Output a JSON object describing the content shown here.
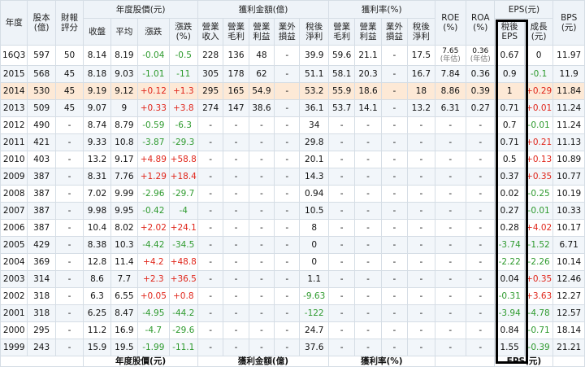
{
  "group_headers": {
    "year": "年度",
    "capital": "股本\n(億)",
    "rating": "財報\n評分",
    "price": "年度股價(元)",
    "profit": "獲利金額(億)",
    "margin": "獲利率(%)",
    "roe": "ROE\n(%)",
    "roa": "ROA\n(%)",
    "eps": "EPS(元)",
    "bps": "BPS\n(元)"
  },
  "sub_headers": {
    "close": "收盤",
    "avg": "平均",
    "change": "漲跌",
    "change_pct": "漲跌\n(%)",
    "rev": "營業\n收入",
    "gross": "營業\n毛利",
    "opinc": "營業\n利益",
    "nonop": "業外\n損益",
    "net": "稅後\n淨利",
    "m_gross": "營業\n毛利",
    "m_op": "營業\n利益",
    "m_nonop": "業外\n損益",
    "m_net": "稅後\n淨利",
    "eps": "稅後\nEPS",
    "growth": "成長\n(元)"
  },
  "footer_labels": [
    "年度股價(元)",
    "獲利金額(億)",
    "獲利率(%)",
    "EPS(元)"
  ],
  "rows": [
    [
      "16Q3",
      "597",
      "50",
      "8.14",
      "8.19",
      "-0.04",
      "-0.5",
      "228",
      "136",
      "48",
      "-",
      "39.9",
      "59.6",
      "21.1",
      "-",
      "17.5",
      "7.65|(年估)",
      "0.36|(年估)",
      "0.67",
      "0",
      "11.97"
    ],
    [
      "2015",
      "568",
      "45",
      "8.18",
      "9.03",
      "-1.01",
      "-11",
      "305",
      "178",
      "62",
      "-",
      "51.1",
      "58.1",
      "20.3",
      "-",
      "16.7",
      "7.84",
      "0.36",
      "0.9",
      "-0.1",
      "11.9"
    ],
    [
      "2014",
      "530",
      "45",
      "9.19",
      "9.12",
      "+0.12",
      "+1.3",
      "295",
      "165",
      "54.9",
      "-",
      "53.2",
      "55.9",
      "18.6",
      "-",
      "18",
      "8.86",
      "0.39",
      "1",
      "+0.29",
      "11.84"
    ],
    [
      "2013",
      "509",
      "45",
      "9.07",
      "9",
      "+0.33",
      "+3.8",
      "274",
      "147",
      "38.6",
      "-",
      "36.1",
      "53.7",
      "14.1",
      "-",
      "13.2",
      "6.31",
      "0.27",
      "0.71",
      "+0.01",
      "11.24"
    ],
    [
      "2012",
      "490",
      "-",
      "8.74",
      "8.79",
      "-0.59",
      "-6.3",
      "-",
      "-",
      "-",
      "-",
      "34",
      "-",
      "-",
      "-",
      "-",
      "-",
      "-",
      "0.7",
      "-0.01",
      "11.24"
    ],
    [
      "2011",
      "421",
      "-",
      "9.33",
      "10.8",
      "-3.87",
      "-29.3",
      "-",
      "-",
      "-",
      "-",
      "29.8",
      "-",
      "-",
      "-",
      "-",
      "-",
      "-",
      "0.71",
      "+0.21",
      "11.13"
    ],
    [
      "2010",
      "403",
      "-",
      "13.2",
      "9.17",
      "+4.89",
      "+58.8",
      "-",
      "-",
      "-",
      "-",
      "20.1",
      "-",
      "-",
      "-",
      "-",
      "-",
      "-",
      "0.5",
      "+0.13",
      "10.89"
    ],
    [
      "2009",
      "387",
      "-",
      "8.31",
      "7.76",
      "+1.29",
      "+18.4",
      "-",
      "-",
      "-",
      "-",
      "14.3",
      "-",
      "-",
      "-",
      "-",
      "-",
      "-",
      "0.37",
      "+0.35",
      "10.77"
    ],
    [
      "2008",
      "387",
      "-",
      "7.02",
      "9.99",
      "-2.96",
      "-29.7",
      "-",
      "-",
      "-",
      "-",
      "0.94",
      "-",
      "-",
      "-",
      "-",
      "-",
      "-",
      "0.02",
      "-0.25",
      "10.19"
    ],
    [
      "2007",
      "387",
      "-",
      "9.98",
      "9.95",
      "-0.42",
      "-4",
      "-",
      "-",
      "-",
      "-",
      "10.5",
      "-",
      "-",
      "-",
      "-",
      "-",
      "-",
      "0.27",
      "-0.01",
      "10.33"
    ],
    [
      "2006",
      "387",
      "-",
      "10.4",
      "8.02",
      "+2.02",
      "+24.1",
      "-",
      "-",
      "-",
      "-",
      "8",
      "-",
      "-",
      "-",
      "-",
      "-",
      "-",
      "0.28",
      "+4.02",
      "10.17"
    ],
    [
      "2005",
      "429",
      "-",
      "8.38",
      "10.3",
      "-4.42",
      "-34.5",
      "-",
      "-",
      "-",
      "-",
      "0",
      "-",
      "-",
      "-",
      "-",
      "-",
      "-",
      "-3.74",
      "-1.52",
      "6.71"
    ],
    [
      "2004",
      "369",
      "-",
      "12.8",
      "11.4",
      "+4.2",
      "+48.8",
      "-",
      "-",
      "-",
      "-",
      "0",
      "-",
      "-",
      "-",
      "-",
      "-",
      "-",
      "-2.22",
      "-2.26",
      "10.14"
    ],
    [
      "2003",
      "314",
      "-",
      "8.6",
      "7.7",
      "+2.3",
      "+36.5",
      "-",
      "-",
      "-",
      "-",
      "1.1",
      "-",
      "-",
      "-",
      "-",
      "-",
      "-",
      "0.04",
      "+0.35",
      "12.46"
    ],
    [
      "2002",
      "318",
      "-",
      "6.3",
      "6.55",
      "+0.05",
      "+0.8",
      "-",
      "-",
      "-",
      "-",
      "-9.63",
      "-",
      "-",
      "-",
      "-",
      "-",
      "-",
      "-0.31",
      "+3.63",
      "12.27"
    ],
    [
      "2001",
      "318",
      "-",
      "6.25",
      "8.47",
      "-4.95",
      "-44.2",
      "-",
      "-",
      "-",
      "-",
      "-122",
      "-",
      "-",
      "-",
      "-",
      "-",
      "-",
      "-3.94",
      "-4.78",
      "12.57"
    ],
    [
      "2000",
      "295",
      "-",
      "11.2",
      "16.9",
      "-4.7",
      "-29.6",
      "-",
      "-",
      "-",
      "-",
      "24.7",
      "-",
      "-",
      "-",
      "-",
      "-",
      "-",
      "0.84",
      "-0.71",
      "18.14"
    ],
    [
      "1999",
      "243",
      "-",
      "15.9",
      "19.5",
      "-1.99",
      "-11.1",
      "-",
      "-",
      "-",
      "-",
      "37.6",
      "-",
      "-",
      "-",
      "-",
      "-",
      "-",
      "1.55",
      "-0.39",
      "21.21"
    ]
  ],
  "column_names": [
    "year",
    "capital",
    "rating",
    "close",
    "avg",
    "change",
    "change-pct",
    "revenue",
    "gross-profit",
    "op-income",
    "non-op",
    "net-income",
    "gross-margin",
    "op-margin",
    "non-op-margin",
    "net-margin",
    "roe",
    "roa",
    "eps",
    "eps-growth",
    "bps"
  ],
  "colors": {
    "header_bg": "#eef3f8",
    "alt_row": "#f2f6fa",
    "highlight_row": "#fde9d6",
    "positive": "#e0261b",
    "negative": "#2e9a2e",
    "frame": "#000000"
  }
}
